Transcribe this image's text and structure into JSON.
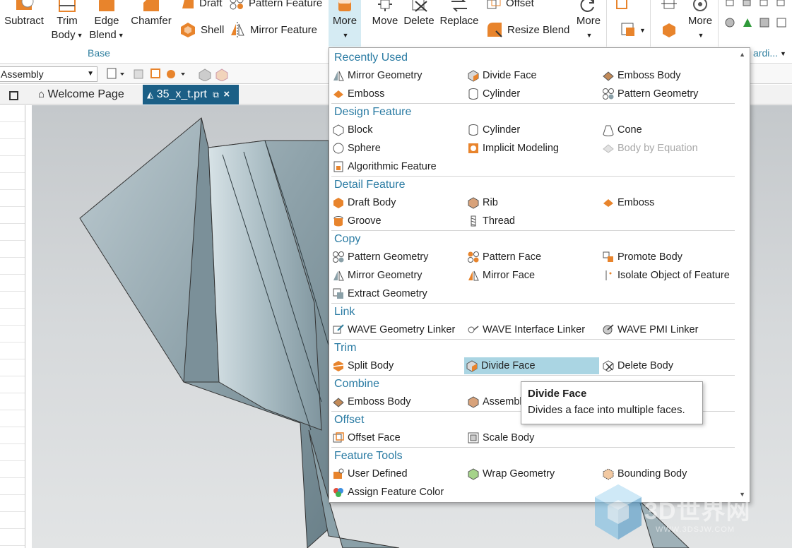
{
  "ribbon": {
    "subtract": "Subtract",
    "trim_body": [
      "Trim",
      "Body"
    ],
    "edge_blend": [
      "Edge",
      "Blend"
    ],
    "chamfer": "Chamfer",
    "draft": "Draft",
    "shell": "Shell",
    "pattern_feature": "Pattern Feature",
    "mirror_feature": "Mirror Feature",
    "more": "More",
    "move": "Move",
    "delete": "Delete",
    "replace": "Replace",
    "offset": "Offset",
    "resize_blend": "Resize Blend",
    "more2": "More",
    "more3": "More",
    "group_base": "Base",
    "right_group_label": "ardi..."
  },
  "quickbar": {
    "filter_value": "Assembly"
  },
  "tabs": {
    "welcome": "Welcome Page",
    "file": "35_x_t.prt"
  },
  "menu": {
    "recently_used": {
      "title": "Recently Used",
      "items": [
        "Mirror Geometry",
        "Divide Face",
        "Emboss Body",
        "Emboss",
        "Cylinder",
        "Pattern Geometry"
      ]
    },
    "design_feature": {
      "title": "Design Feature",
      "items": [
        "Block",
        "Cylinder",
        "Cone",
        "Sphere",
        "Implicit Modeling",
        "Body by Equation",
        "Algorithmic Feature"
      ]
    },
    "detail_feature": {
      "title": "Detail Feature",
      "items": [
        "Draft Body",
        "Rib",
        "Emboss",
        "Groove",
        "Thread"
      ]
    },
    "copy": {
      "title": "Copy",
      "items": [
        "Pattern Geometry",
        "Pattern Face",
        "Promote Body",
        "Mirror Geometry",
        "Mirror Face",
        "Isolate Object of Feature",
        "Extract Geometry"
      ]
    },
    "link": {
      "title": "Link",
      "items": [
        "WAVE Geometry Linker",
        "WAVE Interface Linker",
        "WAVE PMI Linker"
      ]
    },
    "trim": {
      "title": "Trim",
      "items": [
        "Split Body",
        "Divide Face",
        "Delete Body"
      ]
    },
    "combine": {
      "title": "Combine",
      "items": [
        "Emboss Body",
        "Assembl"
      ]
    },
    "offset": {
      "title": "Offset",
      "items": [
        "Offset Face",
        "Scale Body"
      ]
    },
    "feature_tools": {
      "title": "Feature Tools",
      "items": [
        "User Defined",
        "Wrap Geometry",
        "Bounding Body",
        "Assign Feature Color"
      ]
    }
  },
  "tooltip": {
    "title": "Divide Face",
    "description": "Divides a face into multiple faces."
  },
  "watermark": {
    "text": "3D世界网",
    "url": "WWW.3DSJW.COM"
  },
  "colors": {
    "accent": "#2a7ba3",
    "active_tab": "#1b5f86",
    "hover": "#aad5e3",
    "orange_icon": "#e8842c"
  }
}
